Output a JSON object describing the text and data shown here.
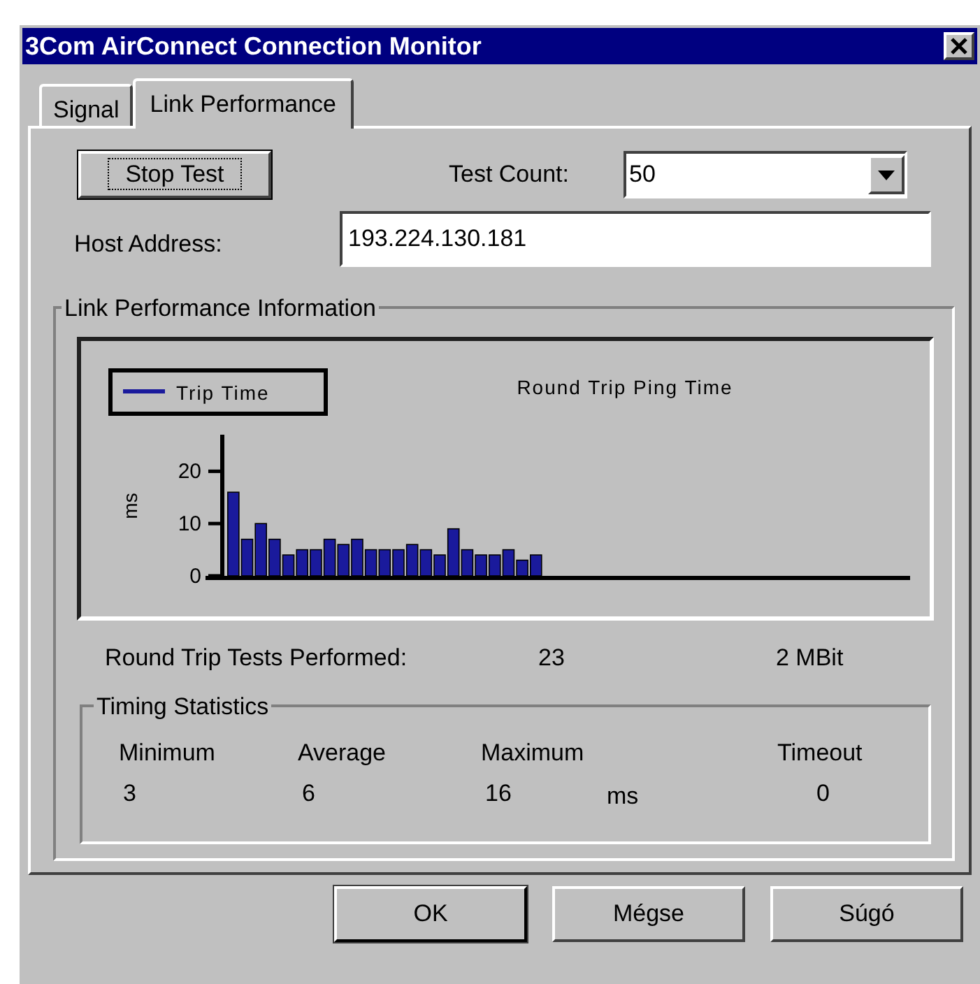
{
  "window": {
    "title": "3Com AirConnect Connection Monitor"
  },
  "tabs": [
    {
      "label": "Signal",
      "selected": false
    },
    {
      "label": "Link Performance",
      "selected": true
    }
  ],
  "stop_button": "Stop Test",
  "test_count": {
    "label": "Test Count:",
    "value": "50"
  },
  "host_address": {
    "label": "Host Address:",
    "value": "193.224.130.181"
  },
  "link_performance_information": {
    "title": "Link Performance Information",
    "chart_data": {
      "type": "bar",
      "title": "Round Trip Ping Time",
      "ylabel": "ms",
      "categories": [
        null,
        null,
        null,
        null,
        null,
        null,
        null,
        null,
        null,
        null,
        null,
        null,
        null,
        null,
        null,
        null,
        null,
        null,
        null,
        null,
        null,
        null,
        null
      ],
      "ylim": [
        0,
        27
      ],
      "yticks": [
        {
          "value": 0,
          "label": "0"
        },
        {
          "value": 10,
          "label": "10"
        },
        {
          "value": 20,
          "label": "20"
        }
      ],
      "series": [
        {
          "name": "Trip Time",
          "color": "#1a1a9c",
          "values": [
            16,
            7,
            10,
            7,
            4,
            5,
            5,
            7,
            6,
            7,
            5,
            5,
            5,
            6,
            5,
            4,
            9,
            5,
            4,
            4,
            5,
            3,
            4
          ]
        }
      ]
    },
    "tests_performed": {
      "label": "Round Trip Tests Performed:",
      "value": "23",
      "rate": "2 MBit"
    },
    "timing_statistics": {
      "title": "Timing Statistics",
      "unit": "ms",
      "columns": [
        {
          "label": "Minimum",
          "value": "3"
        },
        {
          "label": "Average",
          "value": "6"
        },
        {
          "label": "Maximum",
          "value": "16"
        },
        {
          "label": "Timeout",
          "value": "0"
        }
      ]
    }
  },
  "buttons": [
    "OK",
    "Mégse",
    "Súgó"
  ]
}
